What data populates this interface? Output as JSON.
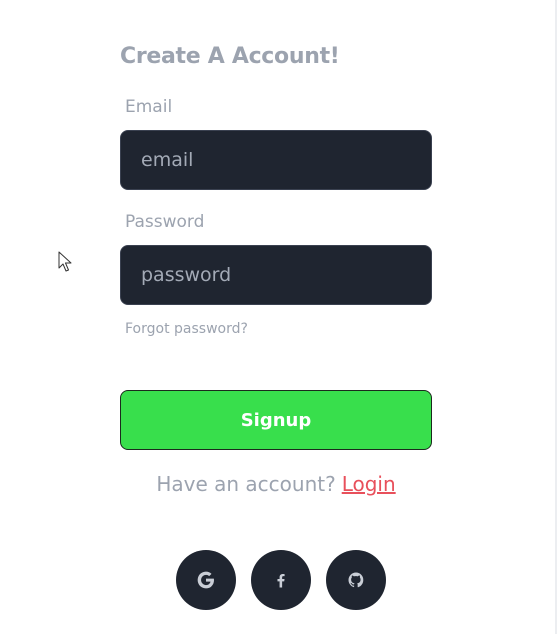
{
  "form": {
    "title": "Create A Account!",
    "email_label": "Email",
    "email_placeholder": "email",
    "email_value": "",
    "password_label": "Password",
    "password_placeholder": "password",
    "password_value": "",
    "forgot_password": "Forgot password?",
    "signup_label": "Signup",
    "have_account_text": "Have an account?",
    "login_link": "Login"
  },
  "socials": [
    {
      "name": "google",
      "icon": "google-icon"
    },
    {
      "name": "facebook",
      "icon": "facebook-icon"
    },
    {
      "name": "github",
      "icon": "github-icon"
    }
  ],
  "colors": {
    "input_bg": "#1f2530",
    "signup_bg": "#38df4c",
    "login_link": "#e8505b",
    "muted_text": "#9ca3af"
  }
}
